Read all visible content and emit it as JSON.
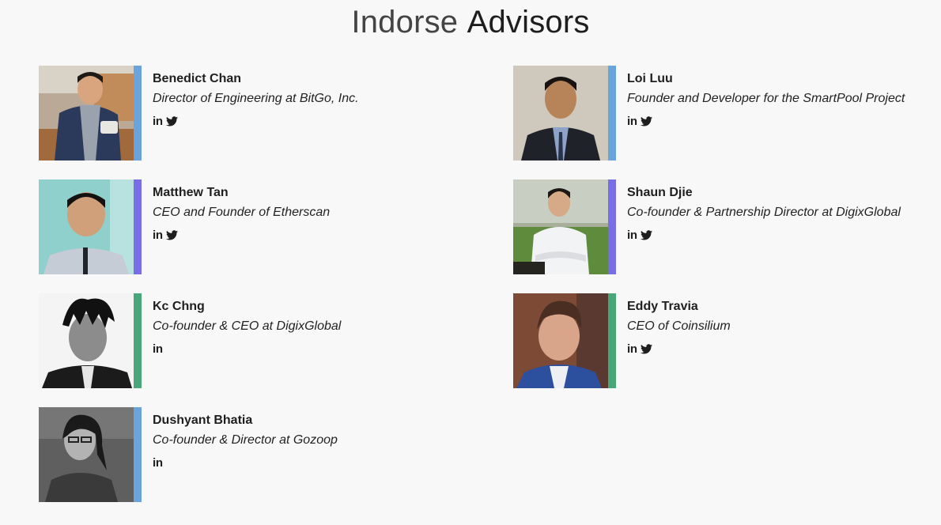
{
  "header": {
    "title_light": "Indorse",
    "title_bold": "Advisors"
  },
  "colors": {
    "blue": "#6aa4dc",
    "purple": "#7a6ee6",
    "green": "#48a77a"
  },
  "advisors": [
    {
      "name": "Benedict Chan",
      "role": "Director of Engineering at BitGo, Inc.",
      "accent": "blue",
      "linkedin": "in",
      "twitter": true
    },
    {
      "name": "Loi Luu",
      "role": "Founder and Developer for the SmartPool Project",
      "accent": "blue",
      "linkedin": "in",
      "twitter": true
    },
    {
      "name": "Matthew Tan",
      "role": "CEO and Founder of Etherscan",
      "accent": "purple",
      "linkedin": "in",
      "twitter": true
    },
    {
      "name": "Shaun Djie",
      "role": "Co-founder & Partnership Director at DigixGlobal",
      "accent": "purple",
      "linkedin": "in",
      "twitter": true
    },
    {
      "name": "Kc Chng",
      "role": "Co-founder & CEO at DigixGlobal",
      "accent": "green",
      "linkedin": "in",
      "twitter": false
    },
    {
      "name": "Eddy Travia",
      "role": "CEO of Coinsilium",
      "accent": "green",
      "linkedin": "in",
      "twitter": true
    },
    {
      "name": "Dushyant Bhatia",
      "role": "Co-founder & Director at Gozoop",
      "accent": "blue",
      "linkedin": "in",
      "twitter": false
    }
  ]
}
